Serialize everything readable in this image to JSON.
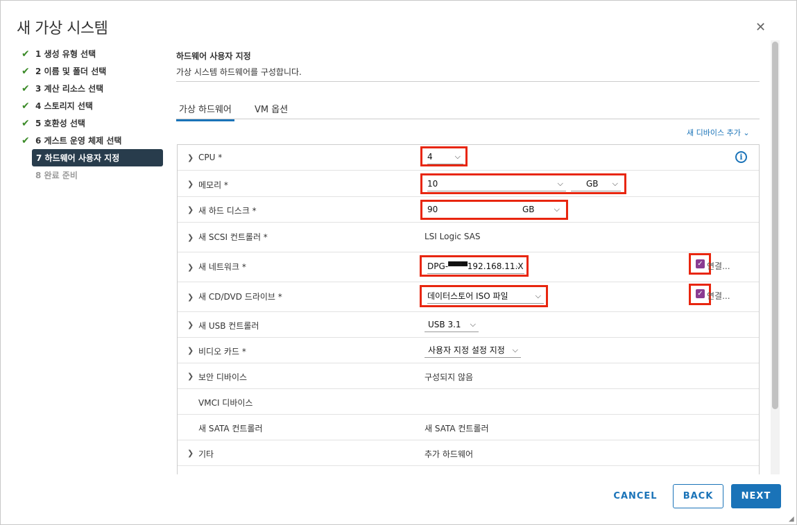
{
  "dialog": {
    "title": "새 가상 시스템"
  },
  "steps": [
    {
      "label": "1 생성 유형 선택",
      "state": "done"
    },
    {
      "label": "2 이름 및 폴더 선택",
      "state": "done"
    },
    {
      "label": "3 계산 리소스 선택",
      "state": "done"
    },
    {
      "label": "4 스토리지 선택",
      "state": "done"
    },
    {
      "label": "5 호환성 선택",
      "state": "done"
    },
    {
      "label": "6 게스트 운영 체제 선택",
      "state": "done"
    },
    {
      "label": "7 하드웨어 사용자 지정",
      "state": "active"
    },
    {
      "label": "8 완료 준비",
      "state": "disabled"
    }
  ],
  "section": {
    "title": "하드웨어 사용자 지정",
    "subtitle": "가상 시스템 하드웨어를 구성합니다."
  },
  "tabs": [
    {
      "label": "가상 하드웨어"
    },
    {
      "label": "VM 옵션"
    }
  ],
  "add_device": "새 디바이스 추가",
  "hardware": {
    "cpu": {
      "label": "CPU *",
      "value": "4"
    },
    "memory": {
      "label": "메모리 *",
      "value": "10",
      "unit": "GB"
    },
    "disk": {
      "label": "새 하드 디스크 *",
      "value": "90",
      "unit": "GB"
    },
    "scsi": {
      "label": "새 SCSI 컨트롤러 *",
      "value": "LSI Logic SAS"
    },
    "network": {
      "label": "새 네트워크 *",
      "value": "DPG-▀▀▀192.168.11.X",
      "connect": "연결..."
    },
    "cddvd": {
      "label": "새 CD/DVD 드라이브 *",
      "value": "데이터스토어 ISO 파일",
      "connect": "연결..."
    },
    "usb": {
      "label": "새 USB 컨트롤러",
      "value": "USB 3.1"
    },
    "video": {
      "label": "비디오 카드 *",
      "value": "사용자 지정 설정 지정"
    },
    "security": {
      "label": "보안 디바이스",
      "value": "구성되지 않음"
    },
    "vmci": {
      "label": "VMCI 디바이스"
    },
    "sata": {
      "label": "새 SATA 컨트롤러",
      "value": "새 SATA 컨트롤러"
    },
    "other": {
      "label": "기타",
      "value": "추가 하드웨어"
    }
  },
  "buttons": {
    "cancel": "CANCEL",
    "back": "BACK",
    "next": "NEXT"
  },
  "icons": {
    "check": "checkmark-icon",
    "chevron": "chevron-right-icon",
    "info": "info-icon",
    "close": "close-icon"
  },
  "colors": {
    "accent": "#1a73b8",
    "active_step": "#283c4c",
    "highlight": "#e8260f",
    "checkbox": "#8a3c91",
    "done": "#3c8b29"
  }
}
